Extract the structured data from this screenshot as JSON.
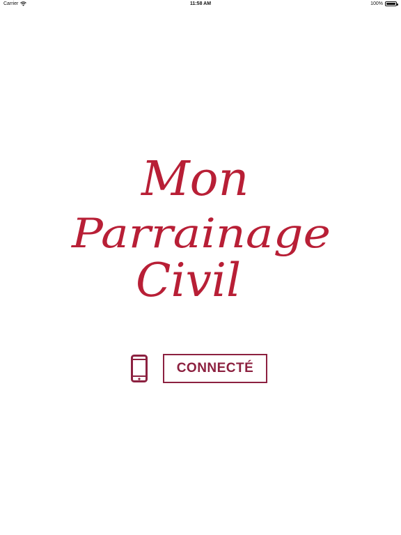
{
  "status_bar": {
    "carrier": "Carrier",
    "time": "11:58 AM",
    "battery_percent": "100%",
    "battery_level": 1.0,
    "wifi_icon": "wifi-icon",
    "battery_icon": "battery-icon"
  },
  "logo": {
    "line1": "Mon",
    "line2": "Parrainage",
    "line3": "Civil",
    "color": "#b81f36"
  },
  "connect": {
    "phone_icon": "phone-icon",
    "button_label": "CONNECTÉ",
    "color": "#8c2140"
  }
}
